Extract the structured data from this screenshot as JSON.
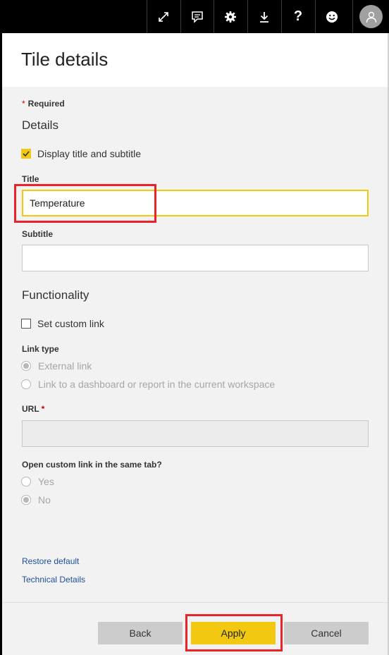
{
  "toolbar": {
    "icons": [
      "expand-icon",
      "comment-icon",
      "settings-icon",
      "download-icon",
      "help-icon",
      "feedback-icon",
      "user-avatar-icon"
    ]
  },
  "panel": {
    "title": "Tile details",
    "required_label": "Required",
    "details": {
      "heading": "Details",
      "display_title_checkbox": {
        "label": "Display title and subtitle",
        "checked": true
      },
      "title_label": "Title",
      "title_value": "Temperature",
      "subtitle_label": "Subtitle",
      "subtitle_value": ""
    },
    "functionality": {
      "heading": "Functionality",
      "custom_link_checkbox": {
        "label": "Set custom link",
        "checked": false
      },
      "link_type_label": "Link type",
      "link_type_options": [
        {
          "label": "External link",
          "selected": true
        },
        {
          "label": "Link to a dashboard or report in the current workspace",
          "selected": false
        }
      ],
      "url_label": "URL",
      "url_value": "",
      "same_tab_label": "Open custom link in the same tab?",
      "same_tab_options": [
        {
          "label": "Yes",
          "selected": false
        },
        {
          "label": "No",
          "selected": true
        }
      ]
    },
    "links": {
      "restore_default": "Restore default",
      "technical_details": "Technical Details"
    }
  },
  "footer": {
    "back_label": "Back",
    "apply_label": "Apply",
    "cancel_label": "Cancel"
  },
  "colors": {
    "accent": "#f2c811",
    "highlight": "#e8232a",
    "required_star": "#cc0000",
    "link": "#1f4e9a"
  }
}
